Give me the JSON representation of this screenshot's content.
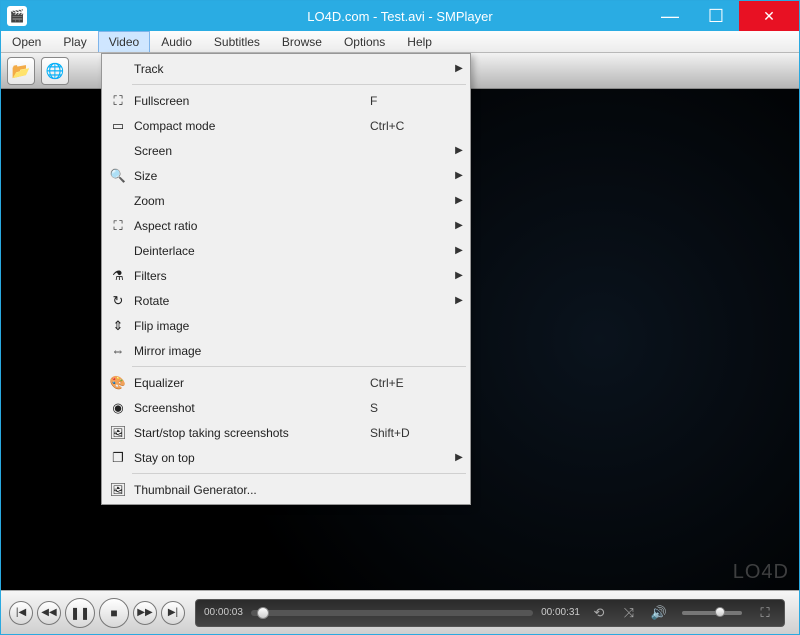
{
  "titlebar": {
    "title": "LO4D.com - Test.avi - SMPlayer"
  },
  "menubar": {
    "items": [
      "Open",
      "Play",
      "Video",
      "Audio",
      "Subtitles",
      "Browse",
      "Options",
      "Help"
    ],
    "active_index": 2
  },
  "toolbar": {
    "open_icon": "📂",
    "web_icon": "🌐"
  },
  "video_menu": {
    "groups": [
      [
        {
          "icon": "",
          "label": "Track",
          "accel": "",
          "submenu": true
        }
      ],
      [
        {
          "icon": "⛶",
          "label": "Fullscreen",
          "accel": "F",
          "submenu": false
        },
        {
          "icon": "▭",
          "label": "Compact mode",
          "accel": "Ctrl+C",
          "submenu": false
        },
        {
          "icon": "",
          "label": "Screen",
          "accel": "",
          "submenu": true
        },
        {
          "icon": "🔍",
          "label": "Size",
          "accel": "",
          "submenu": true
        },
        {
          "icon": "",
          "label": "Zoom",
          "accel": "",
          "submenu": true
        },
        {
          "icon": "⛶",
          "label": "Aspect ratio",
          "accel": "",
          "submenu": true
        },
        {
          "icon": "",
          "label": "Deinterlace",
          "accel": "",
          "submenu": true
        },
        {
          "icon": "⚗",
          "label": "Filters",
          "accel": "",
          "submenu": true
        },
        {
          "icon": "↻",
          "label": "Rotate",
          "accel": "",
          "submenu": true
        },
        {
          "icon": "⇕",
          "label": "Flip image",
          "accel": "",
          "submenu": false
        },
        {
          "icon": "⇔",
          "label": "Mirror image",
          "accel": "",
          "submenu": false
        }
      ],
      [
        {
          "icon": "🎨",
          "label": "Equalizer",
          "accel": "Ctrl+E",
          "submenu": false
        },
        {
          "icon": "◉",
          "label": "Screenshot",
          "accel": "S",
          "submenu": false
        },
        {
          "icon": "🖼",
          "label": "Start/stop taking screenshots",
          "accel": "Shift+D",
          "submenu": false
        },
        {
          "icon": "❐",
          "label": "Stay on top",
          "accel": "",
          "submenu": true
        }
      ],
      [
        {
          "icon": "🖼",
          "label": "Thumbnail Generator...",
          "accel": "",
          "submenu": false
        }
      ]
    ]
  },
  "controls": {
    "time_current": "00:00:03",
    "time_total": "00:00:31"
  },
  "watermark": "LO4D"
}
